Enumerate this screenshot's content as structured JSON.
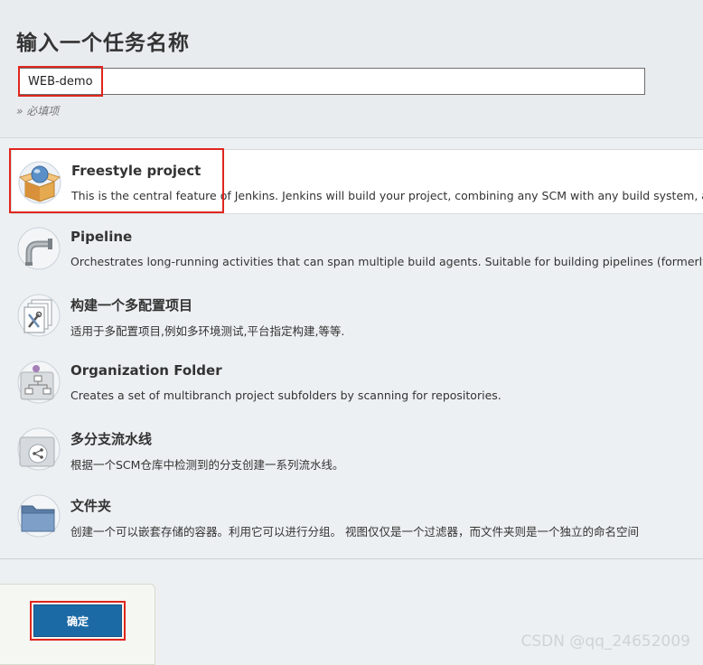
{
  "header": {
    "title": "输入一个任务名称",
    "name_value": "WEB-demo",
    "required_hint": "» 必填项"
  },
  "items": [
    {
      "title": "Freestyle project",
      "description": "This is the central feature of Jenkins. Jenkins will build your project, combining any SCM with any build system, and",
      "icon": "freestyle-box-icon",
      "selected": true
    },
    {
      "title": "Pipeline",
      "description": "Orchestrates long-running activities that can span multiple build agents. Suitable for building pipelines (formerly k",
      "icon": "pipeline-pipe-icon",
      "selected": false
    },
    {
      "title": "构建一个多配置项目",
      "description": "适用于多配置项目,例如多环境测试,平台指定构建,等等.",
      "icon": "multi-config-icon",
      "selected": false
    },
    {
      "title": "Organization Folder",
      "description": "Creates a set of multibranch project subfolders by scanning for repositories.",
      "icon": "organization-folder-icon",
      "selected": false
    },
    {
      "title": "多分支流水线",
      "description": "根据一个SCM仓库中检测到的分支创建一系列流水线。",
      "icon": "multibranch-folder-icon",
      "selected": false
    },
    {
      "title": "文件夹",
      "description": "创建一个可以嵌套存储的容器。利用它可以进行分组。 视图仅仅是一个过滤器，而文件夹则是一个独立的命名空间",
      "icon": "folder-icon",
      "selected": false
    }
  ],
  "footer": {
    "ok_label": "确定"
  },
  "watermark": "CSDN @qq_24652009",
  "colors": {
    "highlight": "#e0261e",
    "primary_button": "#1b6aa5"
  }
}
